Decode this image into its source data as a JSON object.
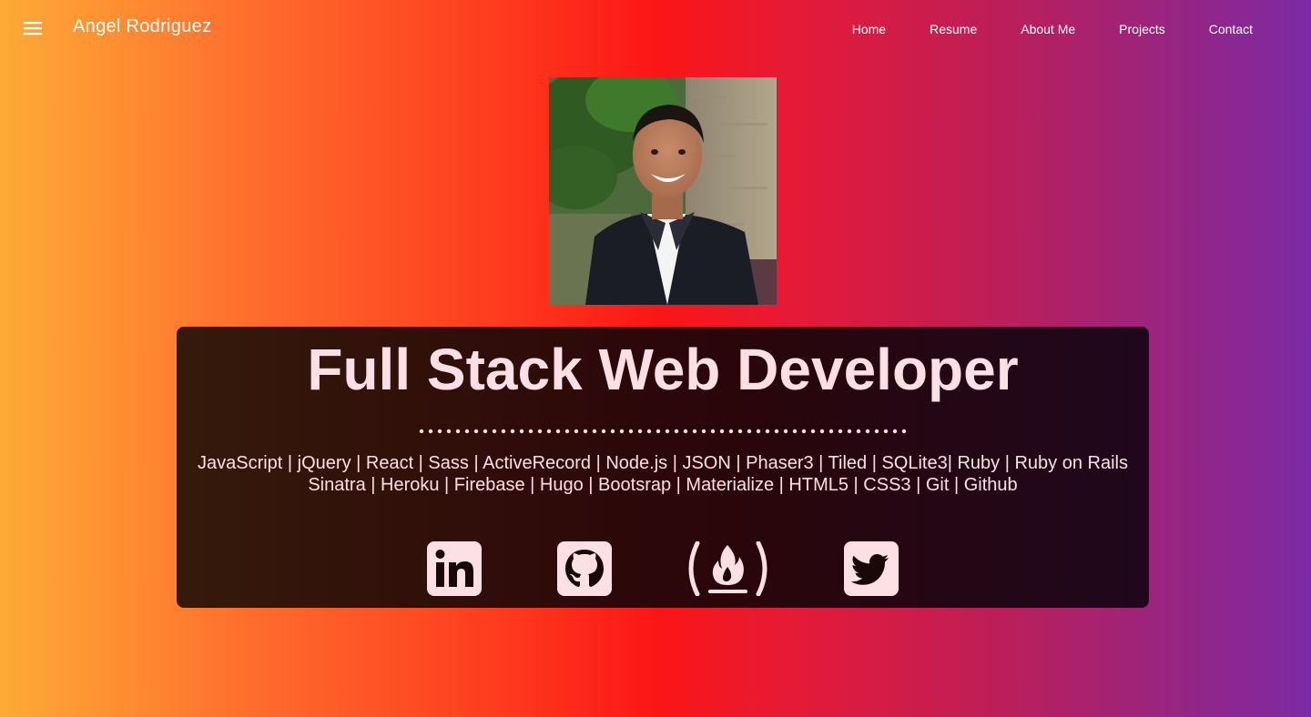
{
  "nav": {
    "menu_icon": "hamburger-menu-icon",
    "brand": "Angel Rodriguez",
    "links": [
      {
        "label": "Home"
      },
      {
        "label": "Resume"
      },
      {
        "label": "About Me"
      },
      {
        "label": "Projects"
      },
      {
        "label": "Contact"
      }
    ]
  },
  "hero": {
    "photo_icon": "profile-photo",
    "headline": "Full Stack Web Developer",
    "skills_line1": "JavaScript | jQuery | React | Sass | ActiveRecord | Node.js | JSON | Phaser3 | Tiled | SQLite3| Ruby | Ruby on Rails",
    "skills_line2": "Sinatra | Heroku | Firebase | Hugo | Bootsrap | Materialize | HTML5 | CSS3 | Git | Github"
  },
  "social": [
    {
      "icon": "linkedin-icon"
    },
    {
      "icon": "github-icon"
    },
    {
      "icon": "freecodecamp-icon"
    },
    {
      "icon": "twitter-icon"
    }
  ],
  "colors": {
    "gradient": [
      "#fdab36",
      "#fb1616",
      "#7b2aa6"
    ],
    "accent_text": "#fde0e5",
    "card_bg": "#1a0808"
  }
}
